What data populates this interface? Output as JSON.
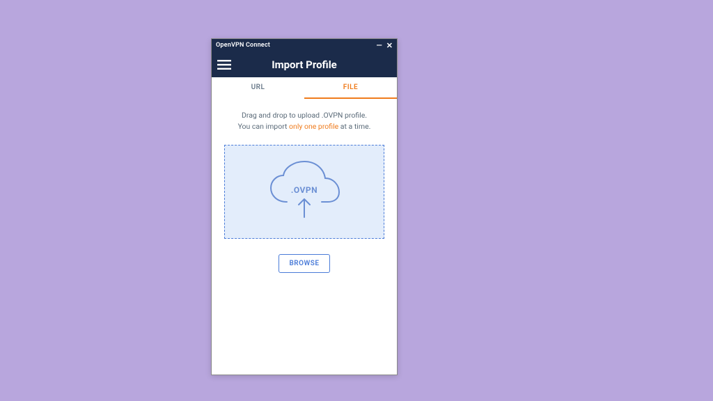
{
  "window": {
    "title": "OpenVPN Connect"
  },
  "header": {
    "title": "Import Profile"
  },
  "tabs": {
    "url": "URL",
    "file": "FILE"
  },
  "instructions": {
    "line1": "Drag and drop to upload .OVPN profile.",
    "line2_pre": "You can import ",
    "line2_highlight": "only one profile",
    "line2_post": " at a time."
  },
  "dropzone": {
    "label": ".OVPN"
  },
  "browse": {
    "label": "BROWSE"
  }
}
